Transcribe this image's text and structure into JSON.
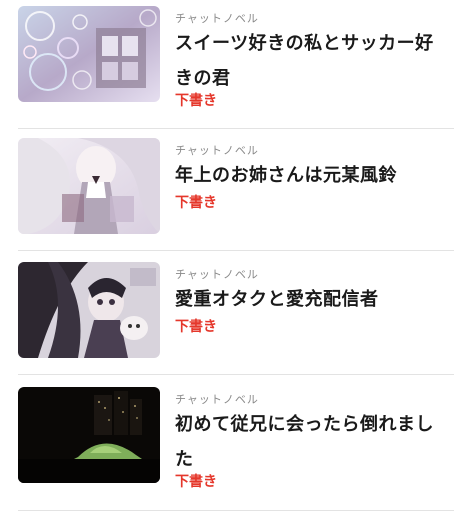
{
  "stories": [
    {
      "genre": "チャットノベル",
      "title": "スイーツ好きの私とサッカー好きの君",
      "status": "下書き",
      "thumbnail": "bubbles-window-illustration"
    },
    {
      "genre": "チャットノベル",
      "title": "年上のお姉さんは元某風鈴",
      "status": "下書き",
      "thumbnail": "pale-haired-girl-illustration"
    },
    {
      "genre": "チャットノベル",
      "title": "愛重オタクと愛充配信者",
      "status": "下書き",
      "thumbnail": "dark-haired-girl-with-plush-illustration"
    },
    {
      "genre": "チャットノベル",
      "title": "初めて従兄に会ったら倒れました",
      "status": "下書き",
      "thumbnail": "night-city-tent-photo"
    }
  ],
  "colors": {
    "status": "#e5372b",
    "genre": "#8a8a8a",
    "title": "#1a1a1a",
    "divider": "#e3e3e3"
  }
}
